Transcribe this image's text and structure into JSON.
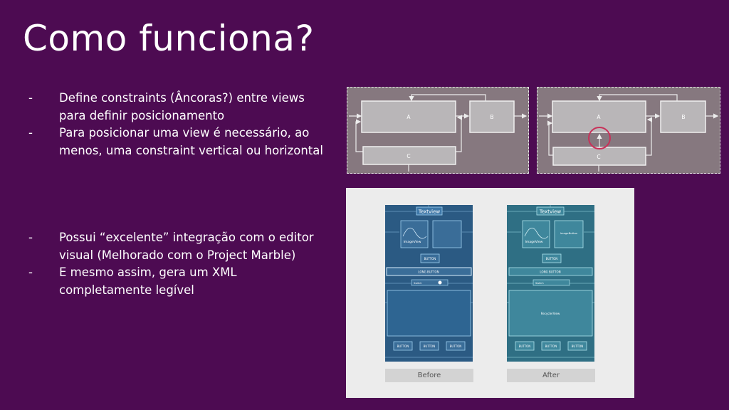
{
  "slide": {
    "title": "Como funciona?",
    "bullets_top": [
      {
        "dash": "-",
        "text": "Define constraints (Âncoras?) entre views para definir posicionamento"
      },
      {
        "dash": "-",
        "text": "Para posicionar uma view é necessário, ao menos, uma constraint vertical ou horizontal"
      }
    ],
    "bullets_bottom": [
      {
        "dash": "-",
        "text": "Possui “excelente” integração com o editor visual (Melhorado com o Project Marble)"
      },
      {
        "dash": "-",
        "text": "E mesmo assim, gera um XML completamente legível"
      }
    ]
  },
  "diagrams": {
    "box_a": "A",
    "box_b": "B",
    "box_c": "C",
    "highlight_color": "#c8325a"
  },
  "layout_editor": {
    "before": {
      "caption": "Before",
      "textview": "Textview",
      "imageview": "ImageView",
      "button": "BUTTON",
      "long_button": "LONG BUTTON",
      "switch": "Switch",
      "bottom_buttons": [
        "BUTTON",
        "BUTTON",
        "BUTTON"
      ]
    },
    "after": {
      "caption": "After",
      "textview": "Textview",
      "imageview": "ImageView",
      "imagebutton": "ImageButton",
      "button": "BUTTON",
      "long_button": "LONG BUTTON",
      "switch": "Switch",
      "recyclerview": "RecyclerView",
      "bottom_buttons": [
        "BUTTON",
        "BUTTON",
        "BUTTON"
      ]
    }
  },
  "colors": {
    "background": "#4d0b52",
    "diagram_bg": "#86787f",
    "blueprint_before": "#2b5a83",
    "blueprint_after": "#2f6f84"
  }
}
